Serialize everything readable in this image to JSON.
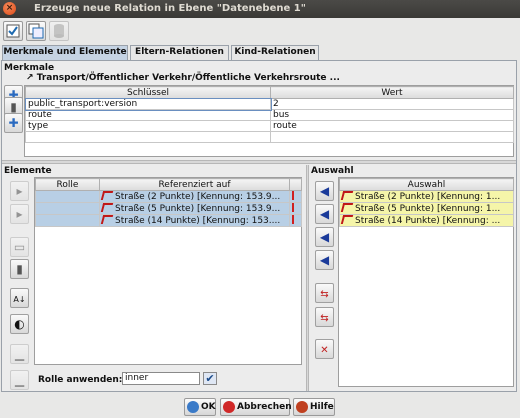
{
  "window": {
    "title": "Erzeuge neue Relation in Ebene \"Datenebene 1\""
  },
  "toolbar": {
    "icons": [
      "apply-icon",
      "copy-icon",
      "database-icon"
    ]
  },
  "tabs": [
    {
      "label": "Merkmale und Elemente"
    },
    {
      "label": "Eltern-Relationen"
    },
    {
      "label": "Kind-Relationen"
    }
  ],
  "merkmale": {
    "section_title": "Merkmale",
    "path": "Transport/Öffentlicher Verkehr/Öffentliche Verkehrsroute ...",
    "columns": [
      "Schlüssel",
      "Wert"
    ],
    "rows": [
      {
        "key": "public_transport:version",
        "value": "2"
      },
      {
        "key": "route",
        "value": "bus"
      },
      {
        "key": "type",
        "value": "route"
      }
    ]
  },
  "elemente": {
    "section_title": "Elemente",
    "columns": [
      "Rolle",
      "Referenziert auf"
    ],
    "rows": [
      {
        "role": "",
        "ref": "Straße (2 Punkte) [Kennung: 153.9..."
      },
      {
        "role": "",
        "ref": "Straße (5 Punkte) [Kennung: 153.9..."
      },
      {
        "role": "",
        "ref": "Straße (14 Punkte) [Kennung: 153...."
      }
    ],
    "role_apply_label": "Rolle anwenden:",
    "role_apply_value": "inner"
  },
  "auswahl": {
    "section_title": "Auswahl",
    "column": "Auswahl",
    "rows": [
      "Straße (2 Punkte) [Kennung: 1...",
      "Straße (5 Punkte) [Kennung: 1...",
      "Straße (14 Punkte) [Kennung: ..."
    ]
  },
  "buttons": {
    "ok": "OK",
    "cancel": "Abbrechen",
    "help": "Hilfe"
  },
  "colors": {
    "selection": "#b8cfe5",
    "selection_highlight": "#f5f5a9",
    "titlebar": "#3f3e3b"
  }
}
